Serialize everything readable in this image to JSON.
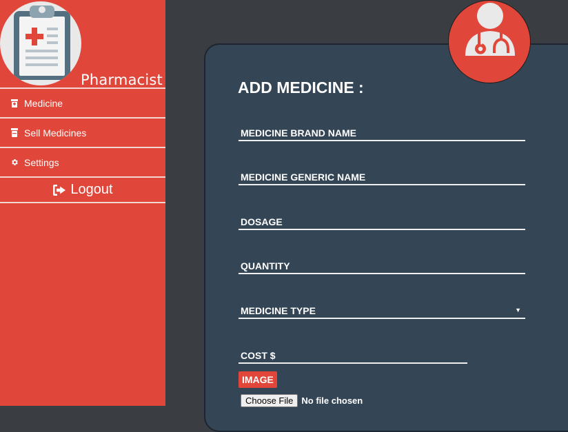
{
  "sidebar": {
    "role_label": "Pharmacist",
    "logo_icon": "clipboard-medical-icon",
    "items": [
      {
        "label": "Medicine",
        "icon": "medicine-bottle-icon"
      },
      {
        "label": "Sell Medicines",
        "icon": "pill-jar-icon"
      },
      {
        "label": "Settings",
        "icon": "gear-icon"
      },
      {
        "label": "Logout",
        "icon": "sign-out-icon"
      }
    ]
  },
  "header": {
    "avatar_icon": "doctor-user-icon"
  },
  "form": {
    "title": "ADD MEDICINE :",
    "fields": {
      "brand_name": "MEDICINE BRAND NAME",
      "generic_name": "MEDICINE GENERIC NAME",
      "dosage": "DOSAGE",
      "quantity": "QUANTITY",
      "medicine_type": "MEDICINE TYPE",
      "cost": "COST $"
    },
    "image_label": "IMAGE",
    "file_button": "Choose File",
    "file_status": "No file chosen"
  },
  "colors": {
    "accent": "#e0463a",
    "card_bg": "#344556",
    "page_bg": "#3a3e42",
    "logo_bg": "#e9e9ea"
  }
}
